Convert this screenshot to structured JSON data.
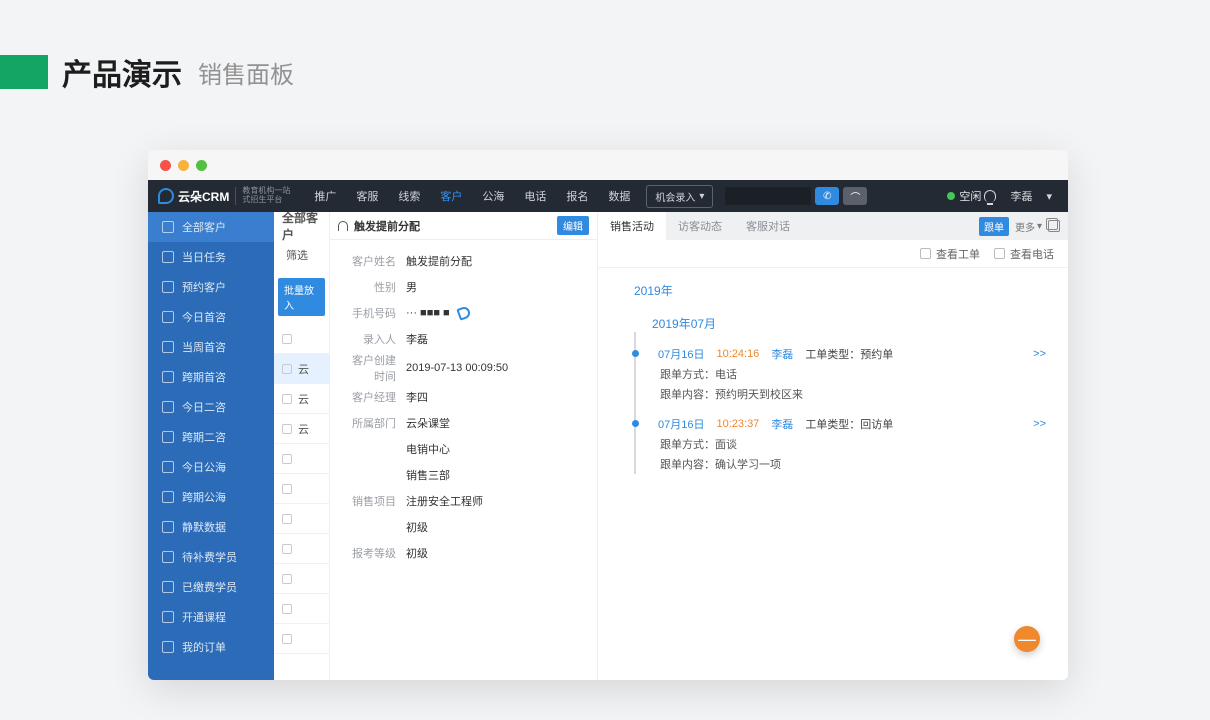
{
  "page_header": {
    "main": "产品演示",
    "sub": "销售面板"
  },
  "topnav": {
    "brand": "云朵CRM",
    "brand_sub1": "教育机构一站",
    "brand_sub2": "式招生平台",
    "items": [
      "推广",
      "客服",
      "线索",
      "客户",
      "公海",
      "电话",
      "报名",
      "数据"
    ],
    "active": "客户",
    "opportunity_btn": "机会录入",
    "status": "空闲",
    "user": "李磊"
  },
  "sidebar": {
    "items": [
      "全部客户",
      "当日任务",
      "预约客户",
      "今日首咨",
      "当周首咨",
      "跨期首咨",
      "今日二咨",
      "跨期二咨",
      "今日公海",
      "跨期公海",
      "静默数据",
      "待补费学员",
      "已缴费学员",
      "开通课程",
      "我的订单"
    ],
    "active_index": 0
  },
  "mid": {
    "title": "全部客户",
    "filter_label": "筛选",
    "batch_btn": "批量放入",
    "rows": [
      "",
      "云",
      "云",
      "云",
      "",
      "",
      "",
      "",
      "",
      "",
      ""
    ]
  },
  "detail": {
    "title": "触发提前分配",
    "edit": "编辑",
    "fields": [
      {
        "label": "客户姓名",
        "value": "触发提前分配"
      },
      {
        "label": "性别",
        "value": "男"
      },
      {
        "label": "手机号码",
        "value": "··· ■■■ ■",
        "phone": true
      },
      {
        "label": "录入人",
        "value": "李磊"
      },
      {
        "label": "客户创建时间",
        "value": "2019-07-13 00:09:50"
      },
      {
        "label": "客户经理",
        "value": "李四"
      },
      {
        "label": "所属部门",
        "value": "云朵课堂"
      },
      {
        "label": "",
        "value": "电销中心"
      },
      {
        "label": "",
        "value": "销售三部"
      },
      {
        "label": "销售项目",
        "value": "注册安全工程师"
      },
      {
        "label": "",
        "value": "初级"
      },
      {
        "label": "报考等级",
        "value": "初级"
      }
    ]
  },
  "timeline": {
    "tabs": [
      "销售活动",
      "访客动态",
      "客服对话"
    ],
    "active_tab": 0,
    "btn_follow": "跟单",
    "btn_more": "更多",
    "chk_ticket": "查看工单",
    "chk_call": "查看电话",
    "year": "2019年",
    "month": "2019年07月",
    "entries": [
      {
        "date": "07月16日",
        "time": "10:24:16",
        "user": "李磊",
        "type_label": "工单类型：",
        "type": "预约单",
        "method_label": "跟单方式：",
        "method": "电话",
        "content_label": "跟单内容：",
        "content": "预约明天到校区来",
        "more": ">>"
      },
      {
        "date": "07月16日",
        "time": "10:23:37",
        "user": "李磊",
        "type_label": "工单类型：",
        "type": "回访单",
        "method_label": "跟单方式：",
        "method": "面谈",
        "content_label": "跟单内容：",
        "content": "确认学习一项",
        "more": ">>"
      }
    ]
  }
}
